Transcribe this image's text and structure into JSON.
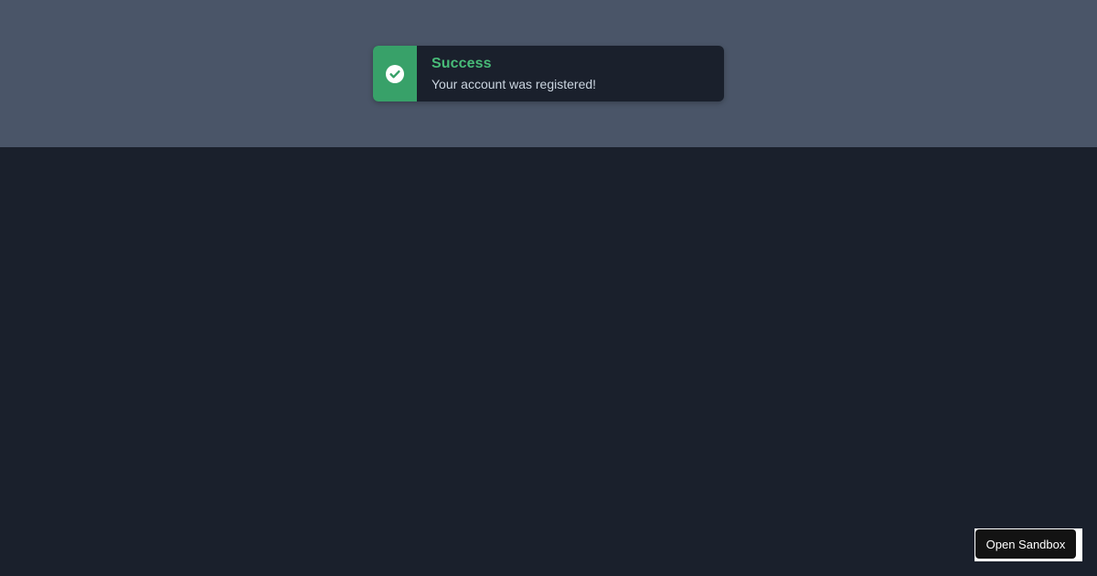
{
  "toast": {
    "status": "success",
    "title": "Success",
    "message": "Your account was registered!",
    "icon": "check-circle-icon",
    "accent_color": "#38a169",
    "title_color": "#48bb78"
  },
  "sandbox": {
    "button_label": "Open Sandbox"
  },
  "colors": {
    "top_band": "#4a5568",
    "page_background": "#1a202c"
  }
}
